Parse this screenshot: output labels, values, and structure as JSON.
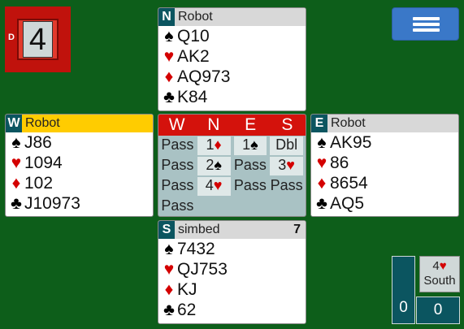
{
  "board": {
    "number": "4",
    "dealer": "D"
  },
  "colors": {
    "table": "#0d5e1a",
    "seat": "#0b5560",
    "red_suit": "#d40000",
    "bid_header": "#d4120c",
    "highlight_player": "#ffcc00"
  },
  "north": {
    "seat": "N",
    "name": "Robot",
    "spades": "Q10",
    "hearts": "AK2",
    "diamonds": "AQ973",
    "clubs": "K84"
  },
  "west": {
    "seat": "W",
    "name": "Robot",
    "spades": "J86",
    "hearts": "1094",
    "diamonds": "102",
    "clubs": "J10973"
  },
  "east": {
    "seat": "E",
    "name": "Robot",
    "spades": "AK95",
    "hearts": "86",
    "diamonds": "8654",
    "clubs": "AQ5"
  },
  "south": {
    "seat": "S",
    "name": "simbed",
    "tricks": "7",
    "spades": "7432",
    "hearts": "QJ753",
    "diamonds": "KJ",
    "clubs": "62"
  },
  "suits": {
    "spade": "♠",
    "heart": "♥",
    "diamond": "♦",
    "club": "♣"
  },
  "bidding": {
    "headers": [
      "W",
      "N",
      "E",
      "S"
    ],
    "rows": [
      [
        {
          "text": "Pass",
          "hl": false
        },
        {
          "level": "1",
          "suit": "♦",
          "red": true,
          "hl": true
        },
        {
          "level": "1",
          "suit": "♠",
          "red": false,
          "hl": true
        },
        {
          "text": "Dbl",
          "hl": true
        }
      ],
      [
        {
          "text": "Pass",
          "hl": false
        },
        {
          "level": "2",
          "suit": "♠",
          "red": false,
          "hl": true
        },
        {
          "text": "Pass",
          "hl": false
        },
        {
          "level": "3",
          "suit": "♥",
          "red": true,
          "hl": true
        }
      ],
      [
        {
          "text": "Pass",
          "hl": false
        },
        {
          "level": "4",
          "suit": "♥",
          "red": true,
          "hl": true
        },
        {
          "text": "Pass",
          "hl": false
        },
        {
          "text": "Pass",
          "hl": false
        }
      ],
      [
        {
          "text": "Pass",
          "hl": false
        },
        null,
        null,
        null
      ]
    ]
  },
  "contract": {
    "level": "4",
    "suit": "♥",
    "declarer": "South"
  },
  "scores": {
    "ew": "0",
    "ns": "0"
  }
}
